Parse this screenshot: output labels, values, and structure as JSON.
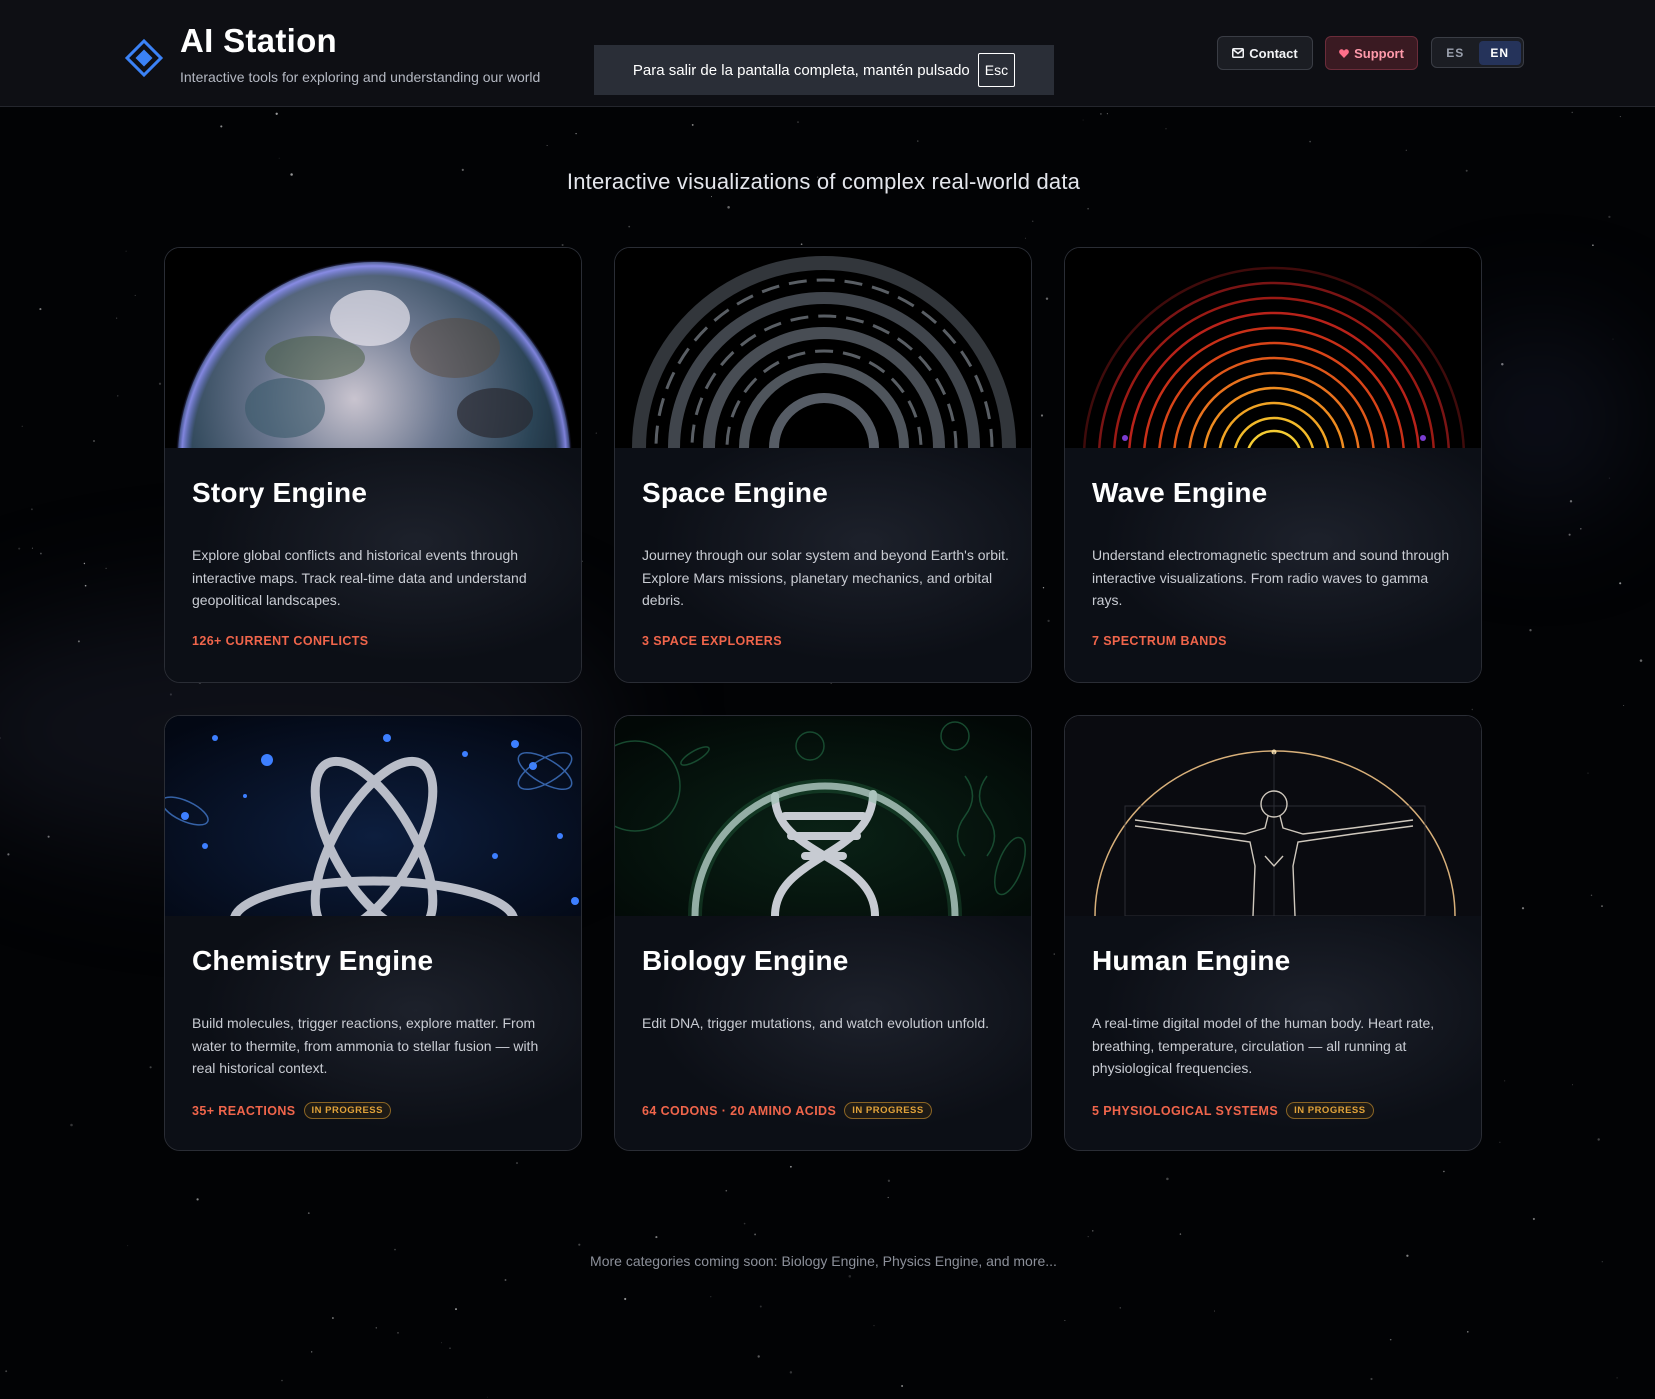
{
  "header": {
    "title": "AI Station",
    "subtitle": "Interactive tools for exploring and understanding our world",
    "fullscreen_banner": {
      "text": "Para salir de la pantalla completa, mantén pulsado",
      "key": "Esc"
    },
    "contact_label": "Contact",
    "support_label": "Support",
    "languages": [
      "ES",
      "EN"
    ],
    "active_language": "EN"
  },
  "tagline": "Interactive visualizations of complex real-world data",
  "cards": [
    {
      "title": "Story Engine",
      "description": "Explore global conflicts and historical events through interactive maps. Track real-time data and understand geopolitical landscapes.",
      "stat": "126+ CURRENT CONFLICTS",
      "badge": "",
      "image": "earth-globe"
    },
    {
      "title": "Space Engine",
      "description": "Journey through our solar system and beyond Earth's orbit. Explore Mars missions, planetary mechanics, and orbital debris.",
      "stat": "3 SPACE EXPLORERS",
      "badge": "",
      "image": "spiral-galaxy"
    },
    {
      "title": "Wave Engine",
      "description": "Understand electromagnetic spectrum and sound through interactive visualizations. From radio waves to gamma rays.",
      "stat": "7 SPECTRUM BANDS",
      "badge": "",
      "image": "spectrum-waves"
    },
    {
      "title": "Chemistry Engine",
      "description": "Build molecules, trigger reactions, explore matter. From water to thermite, from ammonia to stellar fusion — with real historical context.",
      "stat": "35+ REACTIONS",
      "badge": "IN PROGRESS",
      "image": "atom-orbits"
    },
    {
      "title": "Biology Engine",
      "description": "Edit DNA, trigger mutations, and watch evolution unfold.",
      "stat": "64 CODONS · 20 AMINO ACIDS",
      "badge": "IN PROGRESS",
      "image": "dna-helix"
    },
    {
      "title": "Human Engine",
      "description": "A real-time digital model of the human body. Heart rate, breathing, temperature, circulation — all running at physiological frequencies.",
      "stat": "5 PHYSIOLOGICAL SYSTEMS",
      "badge": "IN PROGRESS",
      "image": "vitruvian-figure"
    }
  ],
  "footer_note": "More categories coming soon: Biology Engine, Physics Engine, and more...",
  "colors": {
    "background": "#020305",
    "header": "#0e0f14",
    "accent_blue": "#3b82f6",
    "stat_orange": "#f0654b",
    "badge_amber": "#e0a23a",
    "support_pink": "#ff9aab"
  }
}
